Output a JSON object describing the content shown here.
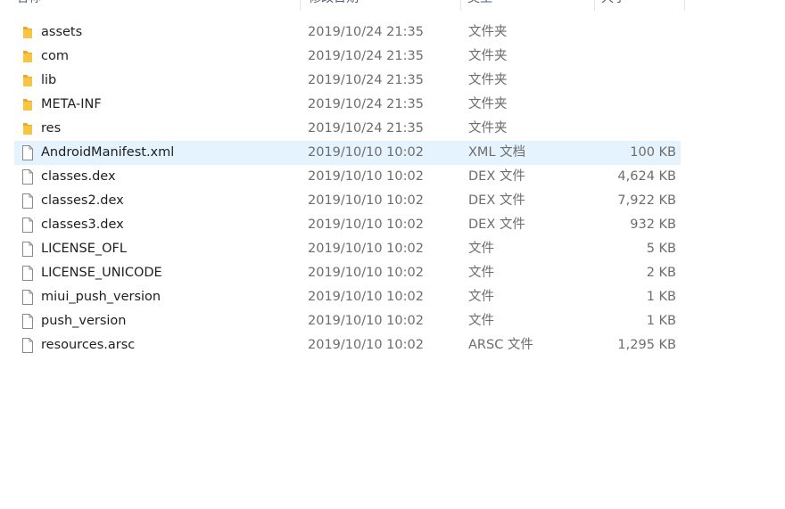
{
  "header": {
    "name": "名称",
    "date": "修改日期",
    "type": "类型",
    "size": "大小"
  },
  "colors": {
    "folder": "#f6c543",
    "selection": "#e5f3ff",
    "secondary_text": "#6d6d6d"
  },
  "files": [
    {
      "name": "assets",
      "date": "2019/10/24 21:35",
      "type": "文件夹",
      "size": "",
      "icon": "folder-icon"
    },
    {
      "name": "com",
      "date": "2019/10/24 21:35",
      "type": "文件夹",
      "size": "",
      "icon": "folder-icon"
    },
    {
      "name": "lib",
      "date": "2019/10/24 21:35",
      "type": "文件夹",
      "size": "",
      "icon": "folder-icon"
    },
    {
      "name": "META-INF",
      "date": "2019/10/24 21:35",
      "type": "文件夹",
      "size": "",
      "icon": "folder-icon"
    },
    {
      "name": "res",
      "date": "2019/10/24 21:35",
      "type": "文件夹",
      "size": "",
      "icon": "folder-icon"
    },
    {
      "name": "AndroidManifest.xml",
      "date": "2019/10/10 10:02",
      "type": "XML 文档",
      "size": "100 KB",
      "icon": "file-icon",
      "selected": true
    },
    {
      "name": "classes.dex",
      "date": "2019/10/10 10:02",
      "type": "DEX 文件",
      "size": "4,624 KB",
      "icon": "file-icon"
    },
    {
      "name": "classes2.dex",
      "date": "2019/10/10 10:02",
      "type": "DEX 文件",
      "size": "7,922 KB",
      "icon": "file-icon"
    },
    {
      "name": "classes3.dex",
      "date": "2019/10/10 10:02",
      "type": "DEX 文件",
      "size": "932 KB",
      "icon": "file-icon"
    },
    {
      "name": "LICENSE_OFL",
      "date": "2019/10/10 10:02",
      "type": "文件",
      "size": "5 KB",
      "icon": "file-icon"
    },
    {
      "name": "LICENSE_UNICODE",
      "date": "2019/10/10 10:02",
      "type": "文件",
      "size": "2 KB",
      "icon": "file-icon"
    },
    {
      "name": "miui_push_version",
      "date": "2019/10/10 10:02",
      "type": "文件",
      "size": "1 KB",
      "icon": "file-icon"
    },
    {
      "name": "push_version",
      "date": "2019/10/10 10:02",
      "type": "文件",
      "size": "1 KB",
      "icon": "file-icon"
    },
    {
      "name": "resources.arsc",
      "date": "2019/10/10 10:02",
      "type": "ARSC 文件",
      "size": "1,295 KB",
      "icon": "file-icon"
    }
  ]
}
